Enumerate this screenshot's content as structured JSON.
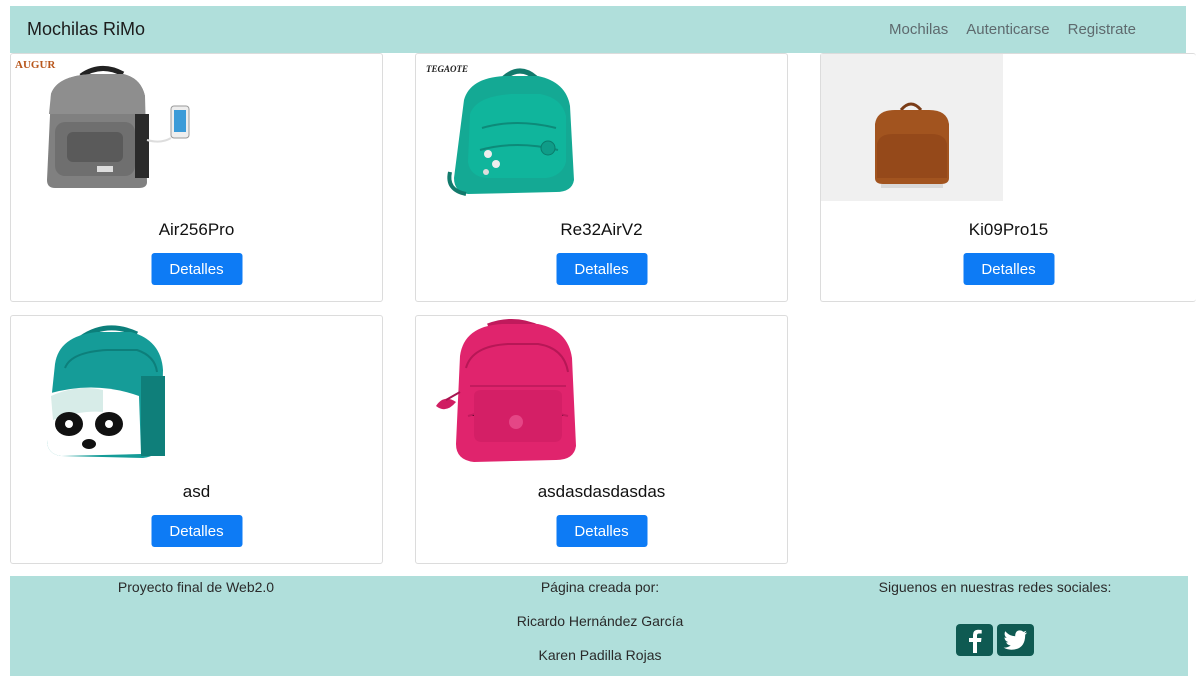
{
  "navbar": {
    "brand": "Mochilas RiMo",
    "links": [
      "Mochilas",
      "Autenticarse",
      "Registrate"
    ]
  },
  "products": [
    {
      "name": "Air256Pro",
      "button": "Detalles",
      "image": "gray-backpack-with-usb-image",
      "logo": "AUGUR"
    },
    {
      "name": "Re32AirV2",
      "button": "Detalles",
      "image": "teal-backpack-image",
      "logo": "TEGAOTE"
    },
    {
      "name": "Ki09Pro15",
      "button": "Detalles",
      "image": "brown-backpack-image"
    },
    {
      "name": "asd",
      "button": "Detalles",
      "image": "panda-backpack-image"
    },
    {
      "name": "asdasdasdasdas",
      "button": "Detalles",
      "image": "pink-backpack-image"
    }
  ],
  "footer": {
    "col1": "Proyecto final de Web2.0",
    "col2": [
      "Página creada por:",
      "Ricardo Hernández García",
      "Karen Padilla Rojas"
    ],
    "col3": "Siguenos en nuestras redes sociales:",
    "social": [
      "facebook-icon",
      "twitter-icon"
    ]
  },
  "colors": {
    "navbar_bg": "#b0dfdb",
    "button_bg": "#0d7bf5",
    "social_bg": "#0f5a52"
  }
}
